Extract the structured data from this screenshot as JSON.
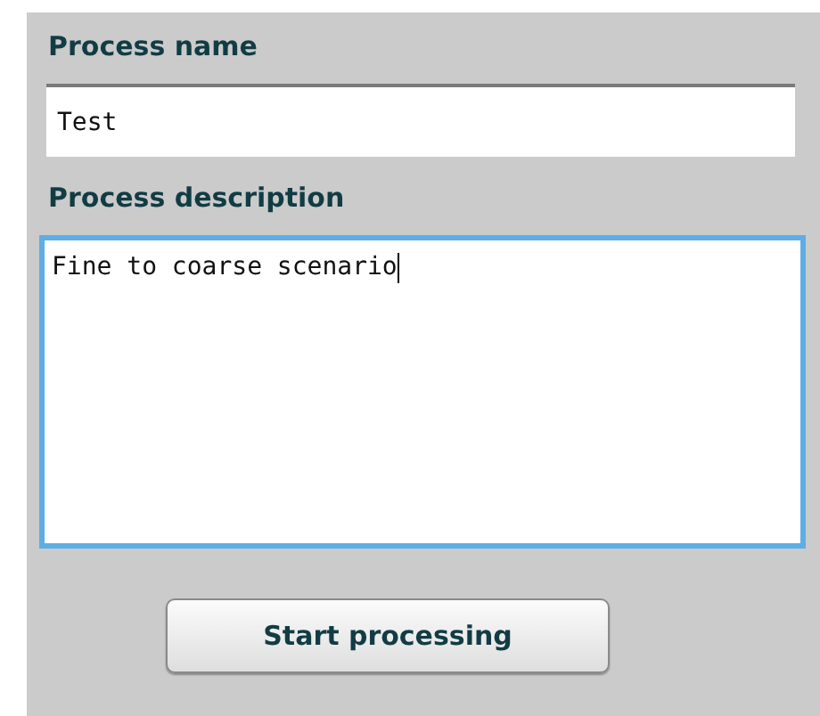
{
  "fields": [
    {
      "kind": "line",
      "label": "Process name",
      "value": "Test",
      "focused": false
    },
    {
      "kind": "area",
      "label": "Process description",
      "value": "Fine to coarse scenario",
      "focused": true
    }
  ],
  "button": {
    "label": "Start processing"
  }
}
